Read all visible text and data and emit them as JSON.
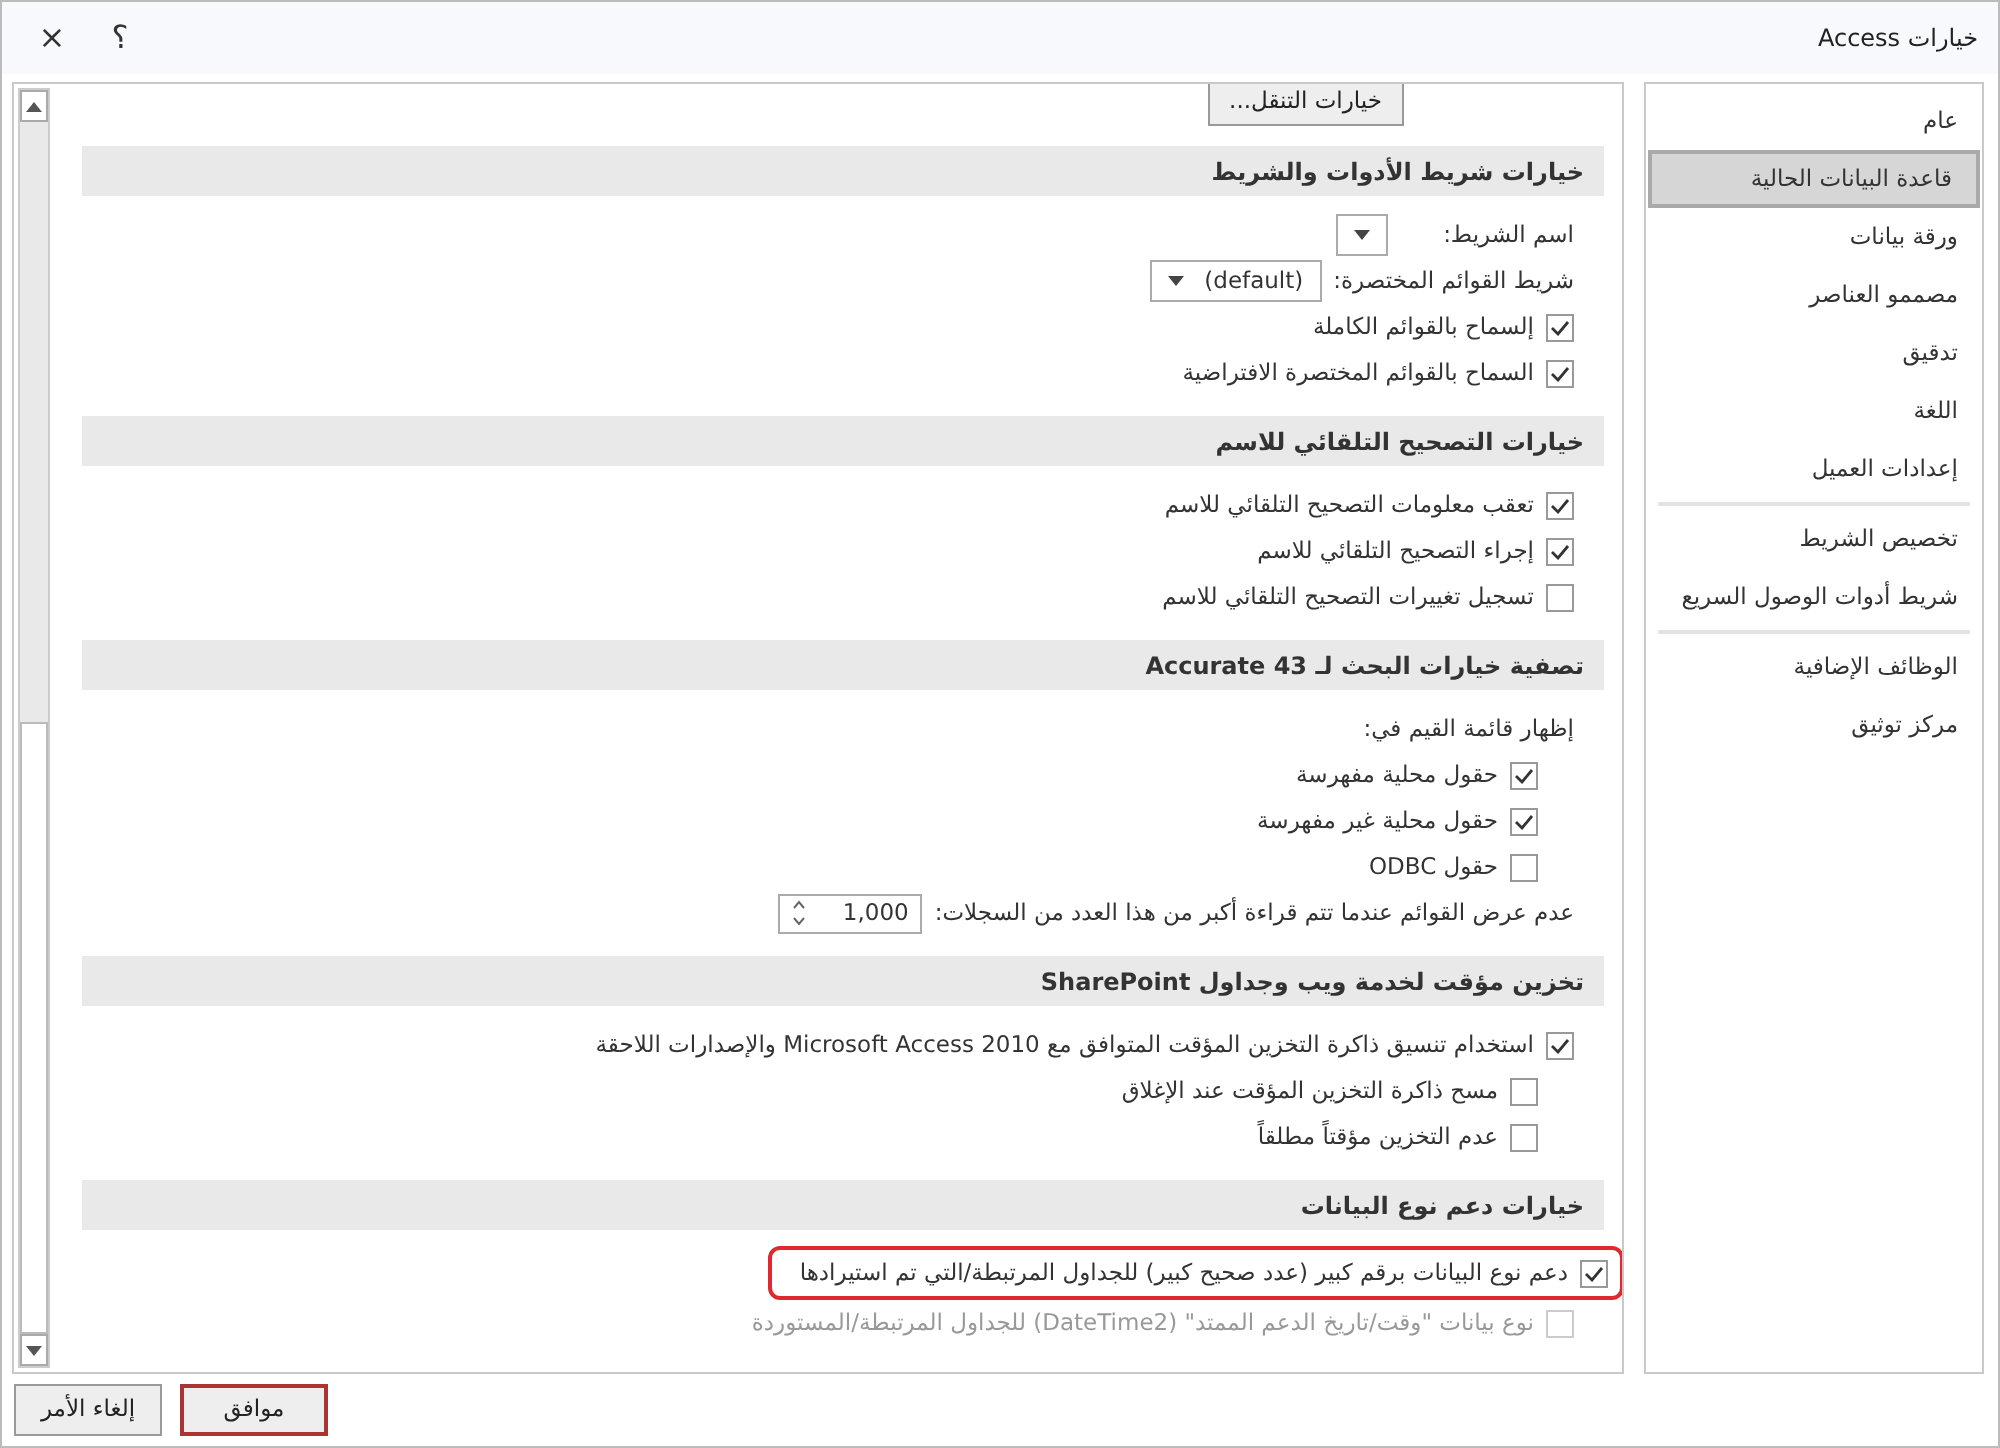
{
  "window": {
    "title": "خيارات Access",
    "help": "؟",
    "close": "×"
  },
  "sidebar": {
    "groups": [
      [
        {
          "label": "عام",
          "selected": false
        },
        {
          "label": "قاعدة البيانات الحالية",
          "selected": true
        },
        {
          "label": "ورقة بيانات",
          "selected": false
        },
        {
          "label": "مصممو العناصر",
          "selected": false
        },
        {
          "label": "تدقيق",
          "selected": false
        },
        {
          "label": "اللغة",
          "selected": false
        },
        {
          "label": "إعدادات العميل",
          "selected": false
        }
      ],
      [
        {
          "label": "تخصيص الشريط",
          "selected": false
        },
        {
          "label": "شريط أدوات الوصول السريع",
          "selected": false
        }
      ],
      [
        {
          "label": "الوظائف الإضافية",
          "selected": false
        },
        {
          "label": "مركز توثيق",
          "selected": false
        }
      ]
    ]
  },
  "nav_button": "خيارات التنقل...",
  "sections": [
    {
      "title": "خيارات شريط الأدوات والشريط",
      "items": [
        {
          "kind": "dropdown",
          "label": "اسم الشريط:"
        },
        {
          "kind": "dropdown",
          "label": "شريط القوائم المختصرة:",
          "value": "(default)"
        },
        {
          "kind": "checkbox",
          "label": "إلسماح بالقوائم الكاملة",
          "checked": true,
          "disabled": false,
          "highlighted": false
        },
        {
          "kind": "checkbox",
          "label": "السماح بالقوائم المختصرة الافتراضية",
          "checked": true,
          "disabled": false,
          "highlighted": false
        }
      ]
    },
    {
      "title": "خيارات التصحيح التلقائي للاسم",
      "items": [
        {
          "kind": "checkbox",
          "label": "تعقب معلومات التصحيح التلقائي للاسم",
          "checked": true,
          "disabled": false,
          "highlighted": false
        },
        {
          "kind": "checkbox",
          "label": "إجراء التصحيح التلقائي للاسم",
          "checked": true,
          "disabled": false,
          "highlighted": false
        },
        {
          "kind": "checkbox",
          "label": "تسجيل تغييرات التصحيح التلقائي للاسم",
          "checked": false,
          "disabled": false,
          "highlighted": false
        }
      ]
    },
    {
      "title": "تصفية خيارات البحث لـ Accurate 43",
      "items": [
        {
          "kind": "label",
          "label": "إظهار قائمة القيم في:",
          "children": [
            {
              "kind": "checkbox",
              "label": "حقول محلية مفهرسة",
              "checked": true,
              "disabled": false,
              "highlighted": false
            },
            {
              "kind": "checkbox",
              "label": "حقول محلية غير مفهرسة",
              "checked": true,
              "disabled": false,
              "highlighted": false
            },
            {
              "kind": "checkbox",
              "label": "حقول ODBC",
              "checked": false,
              "disabled": false,
              "highlighted": false
            }
          ]
        },
        {
          "kind": "number",
          "label": "عدم عرض القوائم عندما تتم قراءة أكبر من هذا العدد من السجلات:",
          "value": "1,000"
        }
      ]
    },
    {
      "title": "تخزين مؤقت لخدمة ويب وجداول SharePoint",
      "items": [
        {
          "kind": "checkbox",
          "label": "استخدام تنسيق ذاكرة التخزين المؤقت المتوافق مع Microsoft Access 2010 والإصدارات اللاحقة",
          "checked": true,
          "disabled": false,
          "highlighted": false
        },
        {
          "kind": "label",
          "children": [
            {
              "kind": "checkbox",
              "label": "مسح ذاكرة التخزين المؤقت عند الإغلاق",
              "checked": false,
              "disabled": false,
              "highlighted": false
            },
            {
              "kind": "checkbox",
              "label": "عدم التخزين مؤقتاً مطلقاً",
              "checked": false,
              "disabled": false,
              "highlighted": false
            }
          ]
        }
      ]
    },
    {
      "title": "خيارات دعم نوع البيانات",
      "items": [
        {
          "kind": "checkbox",
          "label": "دعم نوع البيانات برقم كبير (عدد صحيح كبير) للجداول المرتبطة/التي تم استيرادها",
          "checked": true,
          "disabled": false,
          "highlighted": true
        },
        {
          "kind": "checkbox",
          "label": "نوع بيانات \"وقت/تاريخ الدعم الممتد\" (DateTime2) للجداول المرتبطة/المستوردة",
          "checked": false,
          "disabled": true,
          "highlighted": false
        }
      ]
    }
  ],
  "buttons": [
    {
      "label": "موافق",
      "default": true
    },
    {
      "label": "إلغاء الأمر",
      "default": false
    }
  ]
}
